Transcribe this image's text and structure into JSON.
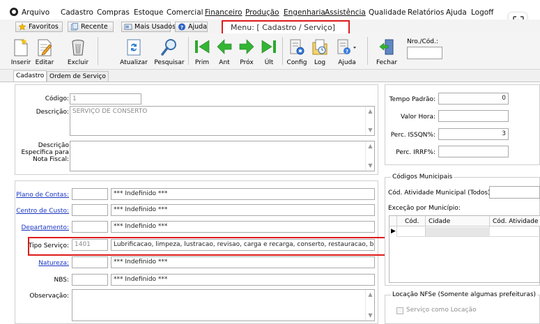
{
  "menubar": {
    "items": [
      "Arquivo",
      "Cadastro",
      "Compras",
      "Estoque",
      "Comercial",
      "Financeiro",
      "Produção",
      "Engenharia",
      "Assistência",
      "Qualidade",
      "Relatórios",
      "Ajuda",
      "Logoff"
    ]
  },
  "favbar": {
    "favoritos": "Favoritos",
    "recente": "Recente",
    "mais_usados": "Mais Usados",
    "ajuda": "Ajuda",
    "menu_title": "Menu: [ Cadastro / Serviço]"
  },
  "toolbar": {
    "inserir": "Inserir",
    "editar": "Editar",
    "excluir": "Excluir",
    "atualizar": "Atualizar",
    "pesquisar": "Pesquisar",
    "prim": "Prim",
    "ant": "Ant",
    "prox": "Próx",
    "ult": "Últ",
    "config": "Config",
    "log": "Log",
    "ajuda": "Ajuda",
    "fechar": "Fechar",
    "nro_cod_label": "Nro./Cód.:",
    "nro_cod_value": ""
  },
  "tabs": [
    "Cadastro",
    "Ordem de Serviço"
  ],
  "form": {
    "codigo_label": "Código:",
    "codigo_value": "1",
    "descricao_label": "Descrição:",
    "descricao_value": "SERVIÇO DE CONSERTO",
    "desc_especifica_label_1": "Descrição",
    "desc_especifica_label_2": "Específica para",
    "desc_especifica_label_3": "Nota Fiscal:",
    "desc_especifica_value": "",
    "plano_contas_label": "Plano de Contas:",
    "plano_contas_code": "",
    "plano_contas_desc": "*** Indefinido ***",
    "centro_custo_label": "Centro de Custo:",
    "centro_custo_code": "",
    "centro_custo_desc": "*** Indefinido ***",
    "departamento_label": "Departamento:",
    "departamento_code": "",
    "departamento_desc": "*** Indefinido ***",
    "tipo_servico_label": "Tipo Serviço:",
    "tipo_servico_code": "1401",
    "tipo_servico_desc": "Lubrificacao, limpeza, lustracao, revisao, carga e recarga, conserto, restauracao, blindagem,",
    "natureza_label": "Natureza:",
    "natureza_code": "",
    "natureza_desc": "*** Indefinido ***",
    "nbs_label": "NBS:",
    "nbs_code": "",
    "nbs_desc": "*** Indefinido ***",
    "observacao_label": "Observação:",
    "observacao_value": ""
  },
  "right": {
    "tempo_padrao_label": "Tempo Padrão:",
    "tempo_padrao_value": "0",
    "valor_hora_label": "Valor Hora:",
    "valor_hora_value": "",
    "perc_issqn_label": "Perc. ISSQN%:",
    "perc_issqn_value": "3",
    "perc_irrf_label": "Perc. IRRF%:",
    "perc_irrf_value": "",
    "codigos_municipais_title": "Códigos Municipais",
    "cod_atividade_label": "Cód. Atividade Municipal (Todos):",
    "cod_atividade_value": "",
    "excecao_label": "Exceção por Município:",
    "grid_headers": [
      "Cód.",
      "Cidade",
      "Cód. Atividade"
    ],
    "locacao_title": "Locação NFSe (Somente algumas prefeituras)",
    "servico_locacao_label": "Serviço como Locação"
  },
  "colors": {
    "highlight": "#e01a1a",
    "link": "#1a35c4"
  }
}
